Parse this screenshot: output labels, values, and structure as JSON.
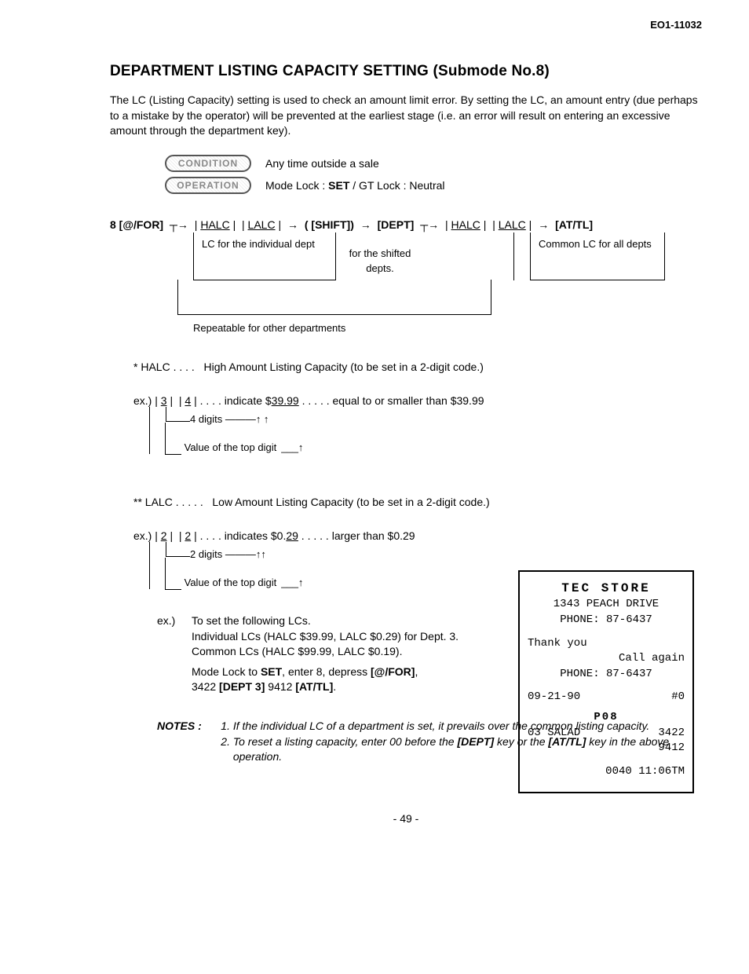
{
  "doc_id": "EO1-11032",
  "title": "DEPARTMENT LISTING CAPACITY SETTING  (Submode No.8)",
  "intro": "The LC (Listing Capacity) setting is used to check an amount limit error.   By setting the LC, an amount entry (due perhaps to a mistake by the operator) will be prevented at the earliest stage (i.e. an error will result on entering an excessive amount through the department key).",
  "condition": {
    "label": "CONDITION",
    "text": "Any time outside a sale"
  },
  "operation": {
    "label": "OPERATION",
    "text_pre": "Mode Lock :  ",
    "text_bold": "SET",
    "text_post": " / GT Lock : Neutral"
  },
  "flow": {
    "start": "8 [@/FOR]",
    "halc": "HALC",
    "lalc": "LALC",
    "shift": "( [SHIFT])",
    "dept": "[DEPT]",
    "end": "[AT/TL]",
    "box1": "LC for the individual dept",
    "box_shift": "for the shifted depts.",
    "box2": "Common LC for all depts",
    "repeat": "Repeatable for other departments"
  },
  "halc_def": {
    "label": "* HALC   . . . .",
    "text": "High Amount Listing Capacity (to be set in a 2-digit code.)",
    "ex_pre": "ex.) | ",
    "d1": "3",
    "d2": "4",
    "ind": " |    . . . .   indicate $",
    "val": "39.99",
    "post": "  . . . . .    equal to or smaller than $39.99",
    "annot1": "4 digits",
    "annot2": "Value of the top digit"
  },
  "lalc_def": {
    "label": "** LALC   . . . . .",
    "text": "Low Amount Listing Capacity (to be set in a 2-digit code.)",
    "ex_pre": "ex.) | ",
    "d1": "2",
    "d2": "2",
    "ind": " |    . . . .   indicates $0.",
    "val": "29",
    "post": "  . . . . .    larger than $0.29",
    "annot1": "2 digits",
    "annot2": "Value of the top digit"
  },
  "example": {
    "lead": "ex.)",
    "l1": "To set the following LCs.",
    "l2": "Individual LCs (HALC $39.99, LALC $0.29) for Dept. 3.",
    "l3": "Common LCs (HALC $99.99, LALC $0.19).",
    "l4a": "Mode Lock to ",
    "l4b": "SET",
    "l4c": ", enter 8, depress ",
    "l4d": "[@/FOR]",
    "l4e": ",",
    "l5a": "3422 ",
    "l5b": "[DEPT 3]",
    "l5c": " 9412 ",
    "l5d": "[AT/TL]",
    "l5e": "."
  },
  "notes": {
    "label": "NOTES :",
    "n1": "If the individual LC of a department is set, it prevails over the common listing capacity.",
    "n2a": "To reset a listing capacity, enter 00 before the ",
    "n2b": "[DEPT]",
    "n2c": " key or the ",
    "n2d": "[AT/TL]",
    "n2e": " key in the above operation."
  },
  "receipt": {
    "store": "TEC  STORE",
    "addr": "1343 PEACH DRIVE",
    "phone1": "PHONE: 87-6437",
    "thank": "Thank you",
    "call": "Call again",
    "phone2": "PHONE: 87-6437",
    "date": "09-21-90",
    "reg": "#0",
    "mode": "P08",
    "item_no": "03",
    "item": "SALAD",
    "v1": "3422",
    "v2": "9412",
    "trans": "0040",
    "time": "11:06TM"
  },
  "page_number": "- 49 -"
}
